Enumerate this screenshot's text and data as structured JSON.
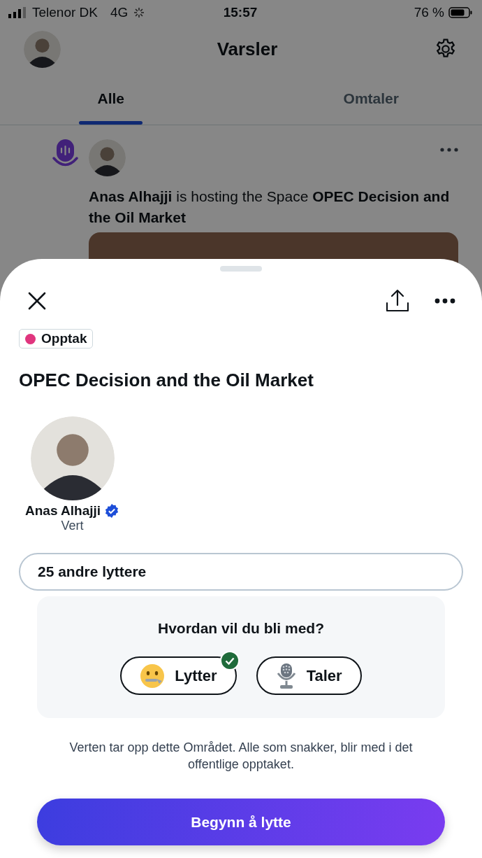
{
  "status_bar": {
    "carrier": "Telenor DK",
    "network": "4G",
    "time": "15:57",
    "battery": "76 %"
  },
  "header": {
    "title": "Varsler"
  },
  "tabs": [
    {
      "label": "Alle",
      "selected": true
    },
    {
      "label": "Omtaler",
      "selected": false
    }
  ],
  "notification": {
    "text": "**Anas Alhajji** is hosting the Space **OPEC Decision and the Oil Market**"
  },
  "sheet": {
    "badge": "Opptak",
    "title": "OPEC Decision and the Oil Market",
    "host": {
      "name": "Anas Alhajji",
      "role": "Vert",
      "verified": true
    },
    "listeners": "25 andre lyttere",
    "question": "Hvordan vil du bli med?",
    "options": [
      {
        "label": "Lytter",
        "kind": "listener",
        "selected": true
      },
      {
        "label": "Taler",
        "kind": "speaker",
        "selected": false
      }
    ],
    "note": "Verten tar opp dette Området. Alle som snakker, blir med i det offentlige opptaket.",
    "button": "Begynn å lytte"
  }
}
